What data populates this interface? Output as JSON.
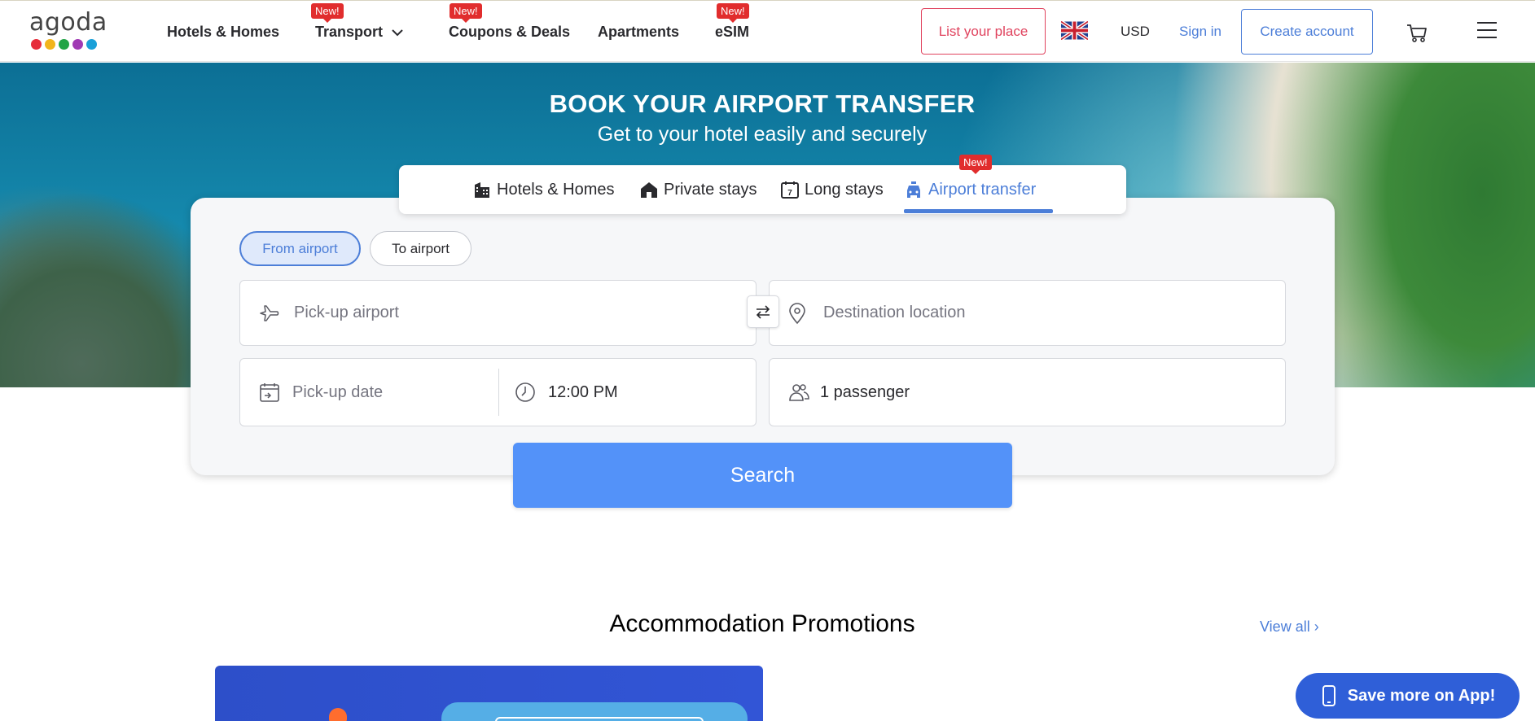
{
  "header": {
    "logo_text": "agoda",
    "logo_dot_colors": [
      "#e62c3a",
      "#f2b51b",
      "#22a446",
      "#a03ab4",
      "#1aa0d8"
    ],
    "nav": [
      {
        "label": "Hotels & Homes",
        "badge": ""
      },
      {
        "label": "Transport",
        "badge": "New!"
      },
      {
        "label": "Coupons & Deals",
        "badge": "New!"
      },
      {
        "label": "Apartments",
        "badge": ""
      },
      {
        "label": "eSIM",
        "badge": "New!"
      }
    ],
    "list_your_place": "List your place",
    "flag_icon": "uk-flag-icon",
    "currency": "USD",
    "sign_in": "Sign in",
    "create_account": "Create account"
  },
  "hero": {
    "title": "BOOK YOUR AIRPORT TRANSFER",
    "subtitle": "Get to your hotel easily and securely"
  },
  "tabs": [
    {
      "label": "Hotels & Homes",
      "icon": "building-icon",
      "active": false
    },
    {
      "label": "Private stays",
      "icon": "house-icon",
      "active": false
    },
    {
      "label": "Long stays",
      "icon": "calendar-7-icon",
      "active": false
    },
    {
      "label": "Airport transfer",
      "icon": "car-icon",
      "active": true,
      "badge": "New!"
    }
  ],
  "direction": {
    "from_airport": "From airport",
    "to_airport": "To airport",
    "selected": "From airport"
  },
  "form": {
    "pickup_placeholder": "Pick-up airport",
    "destination_placeholder": "Destination location",
    "date_placeholder": "Pick-up date",
    "time_value": "12:00 PM",
    "passengers": "1 passenger",
    "search_label": "Search"
  },
  "promotions": {
    "title": "Accommodation Promotions",
    "view_all": "View all ›"
  },
  "app_button": "Save more on App!",
  "colors": {
    "accent_blue": "#5392f9",
    "link_blue": "#4c7ed8",
    "list_place_pink": "#e0435e",
    "badge_red": "#e12d2d"
  }
}
